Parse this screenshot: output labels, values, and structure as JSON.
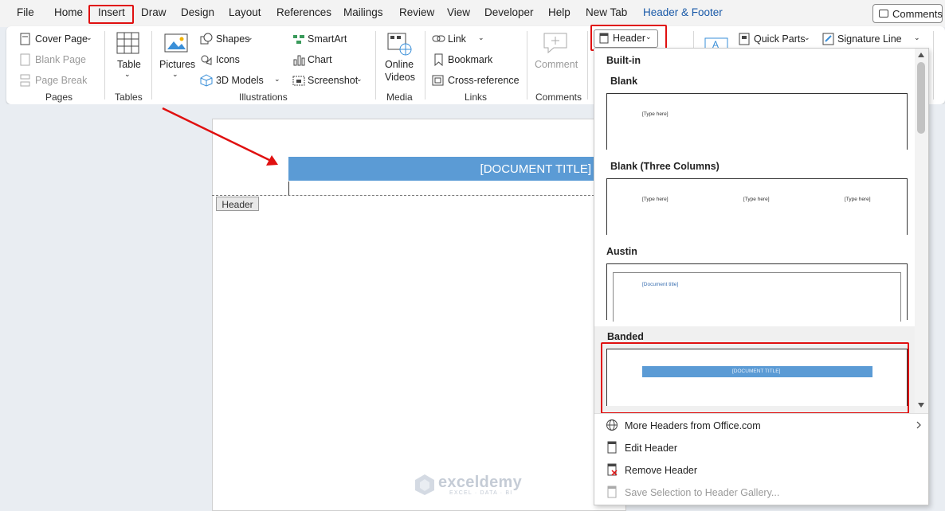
{
  "menubar": {
    "tabs": [
      "File",
      "Home",
      "Insert",
      "Draw",
      "Design",
      "Layout",
      "References",
      "Mailings",
      "Review",
      "View",
      "Developer",
      "Help",
      "New Tab",
      "Header & Footer"
    ],
    "comments_label": "Comments"
  },
  "ribbon": {
    "pages": {
      "cover_page": "Cover Page",
      "blank_page": "Blank Page",
      "page_break": "Page Break",
      "group": "Pages"
    },
    "tables": {
      "table": "Table",
      "group": "Tables"
    },
    "illustrations": {
      "pictures": "Pictures",
      "shapes": "Shapes",
      "icons": "Icons",
      "models": "3D Models",
      "smartart": "SmartArt",
      "chart": "Chart",
      "screenshot": "Screenshot",
      "group": "Illustrations"
    },
    "media": {
      "online": "Online",
      "videos": "Videos",
      "group": "Media"
    },
    "links": {
      "link": "Link",
      "bookmark": "Bookmark",
      "cross_reference": "Cross-reference",
      "group": "Links"
    },
    "comments": {
      "comment": "Comment",
      "group": "Comments"
    },
    "header_footer": {
      "header": "Header"
    },
    "text": {
      "quick_parts": "Quick Parts",
      "signature_line": "Signature Line"
    }
  },
  "document": {
    "title_placeholder": "[DOCUMENT TITLE]",
    "header_tag": "Header"
  },
  "gallery": {
    "section": "Built-in",
    "items": [
      {
        "name": "Blank",
        "placeholders": [
          "[Type here]"
        ]
      },
      {
        "name": "Blank (Three Columns)",
        "placeholders": [
          "[Type here]",
          "[Type here]",
          "[Type here]"
        ]
      },
      {
        "name": "Austin",
        "placeholders": [
          "[Document title]"
        ]
      },
      {
        "name": "Banded",
        "placeholders": [
          "[DOCUMENT TITLE]"
        ]
      }
    ],
    "menu": {
      "more": "More Headers from Office.com",
      "edit": "Edit Header",
      "remove": "Remove Header",
      "save": "Save Selection to Header Gallery..."
    }
  },
  "watermark": {
    "brand": "exceldemy",
    "tagline": "EXCEL · DATA · BI"
  },
  "colors": {
    "accent_blue": "#5b9bd5",
    "highlight_red": "#e01010",
    "hf_tab_blue": "#1a5aa8"
  }
}
